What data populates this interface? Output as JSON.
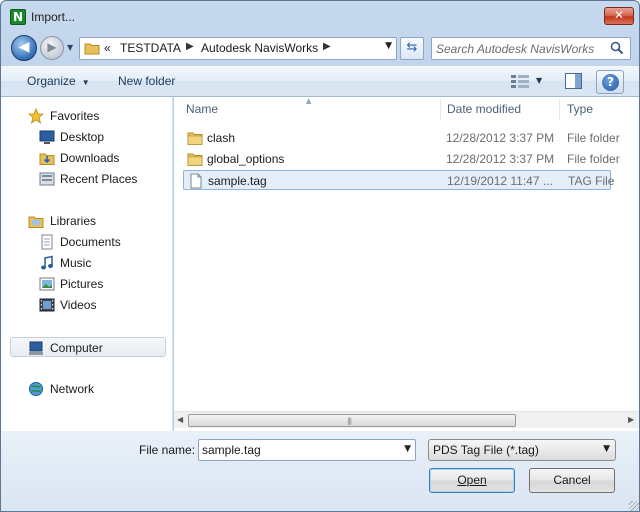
{
  "window": {
    "title": "Import...",
    "app_icon_letter": "N",
    "close_glyph": "✕"
  },
  "nav": {
    "back_glyph": "◀",
    "forward_glyph": "▶",
    "breadcrumb": {
      "overflow": "«",
      "items": [
        "TESTDATA",
        "Autodesk NavisWorks"
      ],
      "separator": "▶"
    },
    "refresh_glyph": "⇆",
    "search_placeholder": "Search Autodesk NavisWorks"
  },
  "toolbar": {
    "organize": "Organize",
    "new_folder": "New folder",
    "help_glyph": "?"
  },
  "sidebar": {
    "favorites": {
      "label": "Favorites",
      "items": [
        {
          "label": "Desktop",
          "icon": "desktop-icon"
        },
        {
          "label": "Downloads",
          "icon": "downloads-icon"
        },
        {
          "label": "Recent Places",
          "icon": "recent-places-icon"
        }
      ]
    },
    "libraries": {
      "label": "Libraries",
      "items": [
        {
          "label": "Documents",
          "icon": "documents-icon"
        },
        {
          "label": "Music",
          "icon": "music-icon"
        },
        {
          "label": "Pictures",
          "icon": "pictures-icon"
        },
        {
          "label": "Videos",
          "icon": "videos-icon"
        }
      ]
    },
    "computer": "Computer",
    "network": "Network"
  },
  "filelist": {
    "columns": [
      "Name",
      "Date modified",
      "Type"
    ],
    "rows": [
      {
        "name": "clash",
        "date": "12/28/2012 3:37 PM",
        "type": "File folder",
        "kind": "folder"
      },
      {
        "name": "global_options",
        "date": "12/28/2012 3:37 PM",
        "type": "File folder",
        "kind": "folder"
      },
      {
        "name": "sample.tag",
        "date": "12/19/2012 11:47 ...",
        "type": "TAG File",
        "kind": "file",
        "selected": true
      }
    ]
  },
  "footer": {
    "file_name_label": "File name:",
    "file_name_value": "sample.tag",
    "file_type_value": "PDS Tag File (*.tag)",
    "open_label": "Open",
    "cancel_label": "Cancel"
  },
  "colors": {
    "accent": "#3c7fb1",
    "selection": "#e4eef9",
    "folder": "#e8c15a"
  }
}
